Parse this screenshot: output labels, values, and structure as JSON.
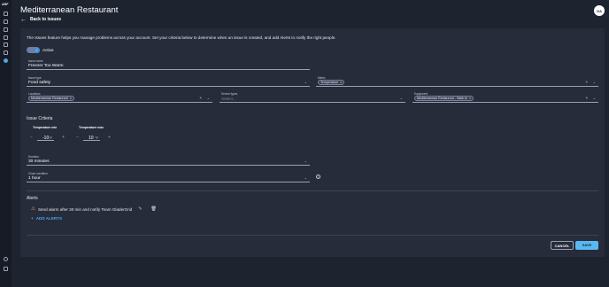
{
  "app": {
    "logo": "ARF",
    "title": "Mediterranean Restaurant",
    "avatar": "GA"
  },
  "nav": {
    "back_label": "Back to issues"
  },
  "sidebar": {
    "icons": [
      "home-icon",
      "grid-icon",
      "shield-icon",
      "document-icon",
      "person-icon",
      "file-icon",
      "issues-icon",
      "help-icon",
      "logout-icon"
    ]
  },
  "intro": "The Issues feature helps you manage problems across your account. Set your criteria below to determine when an issue is created, and add Alerts to notify the right people.",
  "active": {
    "label": "Active",
    "on": true
  },
  "issue_name": {
    "label": "Issue name",
    "value": "Freezer Too Warm"
  },
  "issue_type": {
    "label": "Issue type",
    "value": "Food safety"
  },
  "metric": {
    "label": "Metric",
    "chip": "Temperature"
  },
  "locations": {
    "label": "Locations",
    "chip": "Mediterranean Restaurant"
  },
  "device_types": {
    "label": "Device types",
    "placeholder": "Select..."
  },
  "equipment": {
    "label": "Equipment",
    "chip": "Mediterranean Restaurant - Walk-In"
  },
  "criteria": {
    "title": "Issue Criteria",
    "temp_min": {
      "label": "Temperature min",
      "value": "-10",
      "unit": "°F"
    },
    "temp_max": {
      "label": "Temperature max",
      "value": "10",
      "unit": "°F"
    }
  },
  "duration": {
    "label": "Duration",
    "value": "30 minutes"
  },
  "close_condition": {
    "label": "Close condition",
    "value": "1 hour"
  },
  "alerts": {
    "title": "Alerts",
    "items": [
      "Send alarm after 30 min and notify Team GladerGrid"
    ],
    "add_label": "ADD ALERTS"
  },
  "actions": {
    "cancel": "CANCEL",
    "save": "SAVE"
  },
  "colors": {
    "accent": "#4aa8e8",
    "save": "#5ab8f0",
    "warning": "#e0a63a",
    "background": "#1e2330",
    "card": "#262c3a"
  }
}
